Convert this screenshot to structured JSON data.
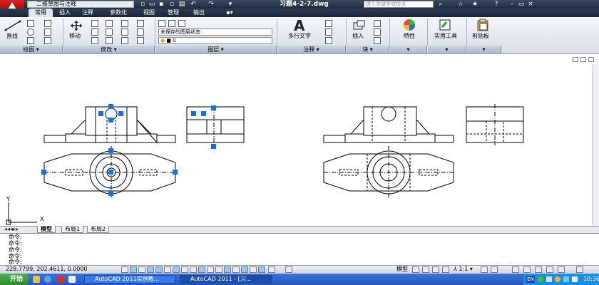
{
  "title_bar": {
    "workspace": "二维草图与注释",
    "document_title": "习题4-2-7.dwg",
    "search_placeholder": "键入关键字或短语"
  },
  "tabs": [
    "常用",
    "插入",
    "注释",
    "参数化",
    "视图",
    "管理",
    "输出"
  ],
  "ribbon": {
    "draw": {
      "line_label": "直线",
      "footer": "绘图"
    },
    "modify": {
      "move_label": "移动",
      "footer": "修改"
    },
    "layers": {
      "state_combo": "未保存的图层状态",
      "layer_combo": "0",
      "footer": "图层"
    },
    "annotation": {
      "mtext_label": "多行文字",
      "footer": "注释"
    },
    "block": {
      "insert_label": "插入",
      "footer": "块"
    },
    "properties": {
      "label": "特性"
    },
    "utilities": {
      "label": "实用工具"
    },
    "clipboard": {
      "label": "剪贴板"
    }
  },
  "layout_tabs": [
    "模型",
    "布局1",
    "布局2"
  ],
  "command_lines": [
    "命令:",
    "命令:",
    "命令:",
    "命令:",
    "命令:"
  ],
  "status": {
    "coords": "228.7799, 202.4611, 0.0000",
    "model": "模型",
    "scale": "1:1"
  },
  "taskbar": {
    "start": "开始",
    "tasks": [
      "AutoCAD 2011实例教...",
      "AutoCAD 2011 - [习..."
    ],
    "clock": "10:36",
    "lang": "EN"
  },
  "ucs": {
    "x": "X",
    "y": "Y"
  }
}
